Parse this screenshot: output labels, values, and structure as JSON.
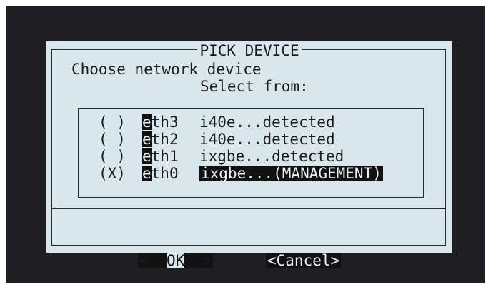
{
  "dialog": {
    "title": "PICK DEVICE",
    "prompt": "Choose network device",
    "select_from": "Select from:"
  },
  "devices": [
    {
      "radio": "( )",
      "hot": "e",
      "rest": "th3",
      "desc": "i40e...detected",
      "selected": false
    },
    {
      "radio": "( )",
      "hot": "e",
      "rest": "th2",
      "desc": "i40e...detected",
      "selected": false
    },
    {
      "radio": "( )",
      "hot": "e",
      "rest": "th1",
      "desc": "ixgbe...detected",
      "selected": false
    },
    {
      "radio": "(X)",
      "hot": "e",
      "rest": "th0",
      "desc": "ixgbe...(MANAGEMENT)",
      "selected": true
    }
  ],
  "buttons": {
    "ok_left": "<  ",
    "ok_k": "OK",
    "ok_right": "  >",
    "cancel": "<Cancel>"
  },
  "colors": {
    "screen_bg": "#1e1e22",
    "dialog_bg": "#d9e6ec",
    "highlight": "#111111"
  }
}
